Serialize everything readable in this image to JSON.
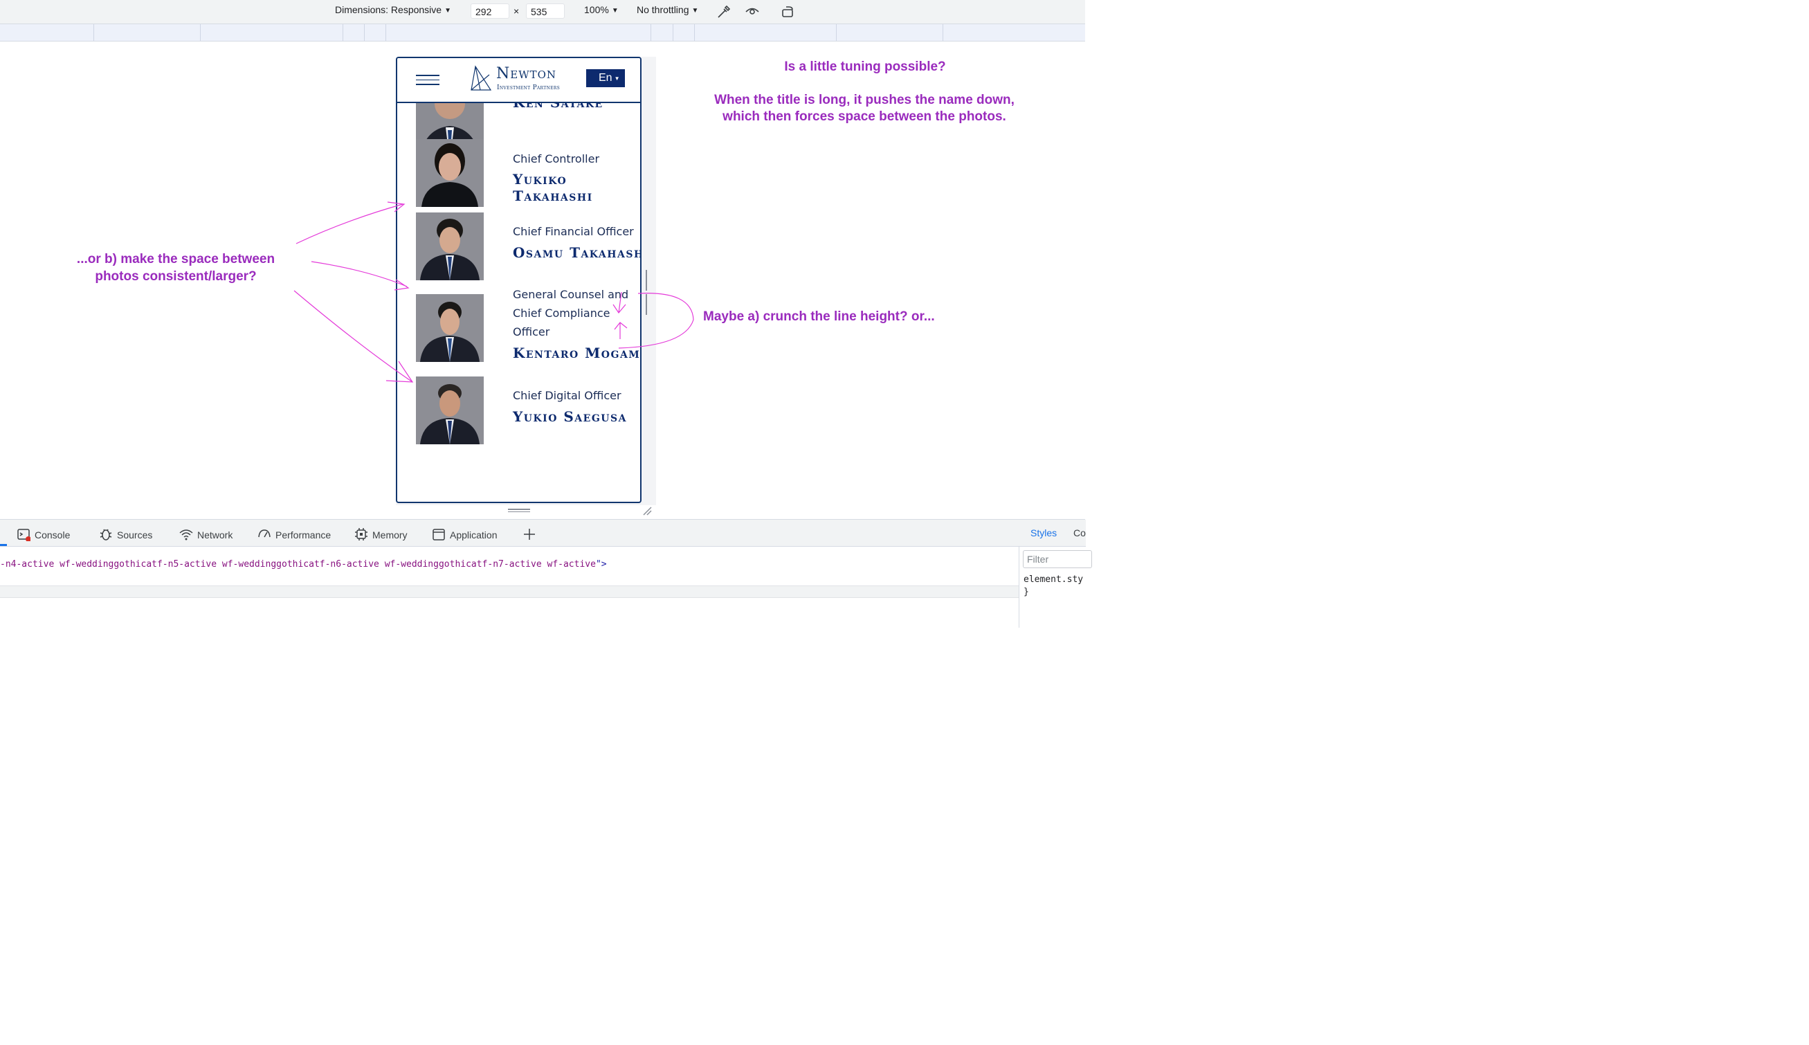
{
  "toolbar": {
    "dimensions_label": "Dimensions: Responsive",
    "width_value": "292",
    "times": "×",
    "height_value": "535",
    "zoom": "100%",
    "throttling": "No throttling",
    "icons": [
      "eyedropper-icon",
      "eye-icon",
      "rotate-icon"
    ]
  },
  "site": {
    "logo_name": "Newton",
    "logo_sub": "Investment Partners",
    "lang_label": "En",
    "accent_color": "#0d2a6e"
  },
  "people": [
    {
      "title": "",
      "name": "Ken Satake"
    },
    {
      "title": "Chief Controller",
      "name": "Yukiko Takahashi"
    },
    {
      "title": "Chief Financial Officer",
      "name": "Osamu Takahashi"
    },
    {
      "title": "General Counsel and Chief Compliance Officer",
      "name": "Kentaro Mogami"
    },
    {
      "title": "Chief Digital Officer",
      "name": "Yukio Saegusa"
    }
  ],
  "annotations": {
    "top_question": "Is a little tuning possible?",
    "top_explanation": "When the title is long, it pushes the name down, which then forces space between the photos.",
    "option_a": "Maybe a) crunch the line height? or...",
    "option_b": "...or b) make the space between photos consistent/larger?",
    "color": "#9a2bbd"
  },
  "devtools": {
    "tabs": [
      "Console",
      "Sources",
      "Network",
      "Performance",
      "Memory",
      "Application"
    ],
    "code_prefix": "-n4-active wf-weddinggothicatf-n5-active wf-weddinggothicatf-n6-active wf-weddinggothicatf-n7-active wf-active",
    "code_suffix": "\">",
    "styles_tab": "Styles",
    "computed_tab": "Co",
    "filter_placeholder": "Filter",
    "element_style": "element.sty",
    "close_brace": "}"
  }
}
